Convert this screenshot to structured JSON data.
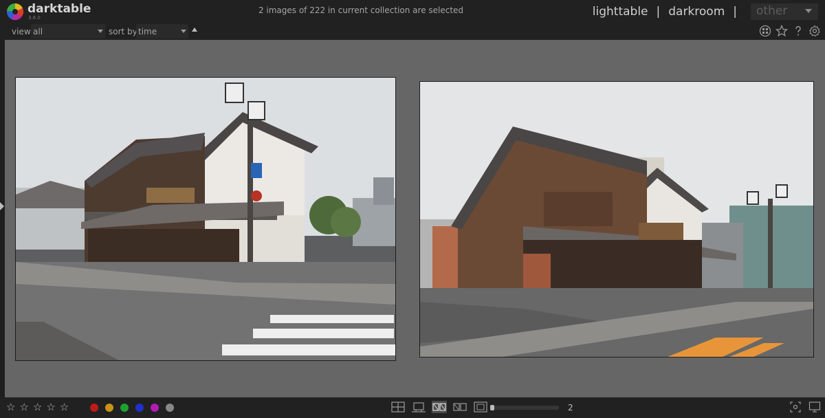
{
  "app": {
    "name": "darktable",
    "version": "3.6.0"
  },
  "header": {
    "selection_status": "2 images of 222 in current collection are selected",
    "views": [
      "lighttable",
      "darkroom"
    ],
    "view_separator": "|",
    "view_other": "other",
    "filter_label": "view",
    "filter_value": "all",
    "sort_label": "sort by",
    "sort_value": "time",
    "icons": [
      "presets-icon",
      "star-icon",
      "help-icon",
      "gear-icon"
    ]
  },
  "bottom": {
    "stars": [
      "☆",
      "☆",
      "☆",
      "☆",
      "☆"
    ],
    "color_labels": [
      "#c0191a",
      "#c79418",
      "#1ea12f",
      "#1e30c8",
      "#b21ab4",
      "#888888"
    ],
    "zoom_value": "2"
  },
  "colors": {
    "center_bg": "#666666",
    "panel_bg": "#212121"
  }
}
